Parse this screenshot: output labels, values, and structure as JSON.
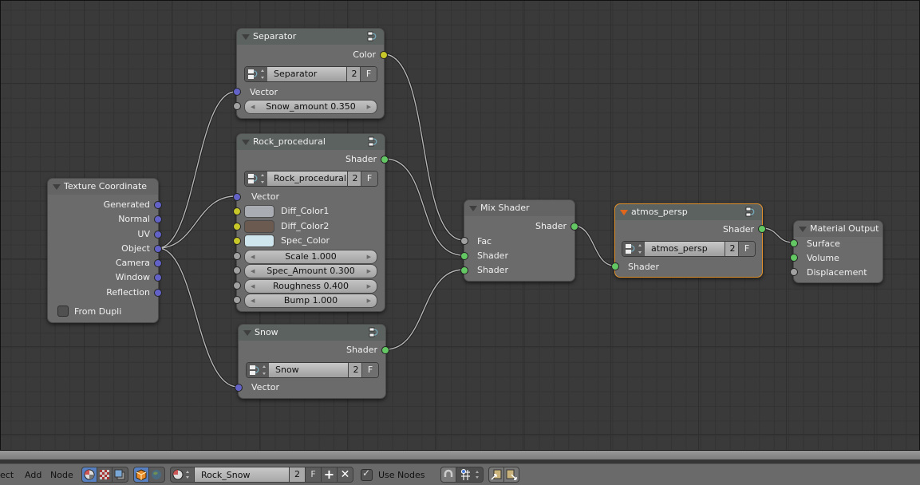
{
  "editor": {
    "colors": {
      "socket_vector": "#6363c7",
      "socket_color": "#c7c729",
      "socket_shader": "#63c763",
      "socket_value": "#a1a1a1",
      "active_outline": "#e0902a"
    },
    "nodes": {
      "texture_coordinate": {
        "title": "Texture Coordinate",
        "outputs": [
          "Generated",
          "Normal",
          "UV",
          "Object",
          "Camera",
          "Window",
          "Reflection"
        ],
        "from_dupli_label": "From Dupli",
        "from_dupli_checked": false
      },
      "separator": {
        "title": "Separator",
        "output_color": "Color",
        "group_name": "Separator",
        "users": "2",
        "fake_user": "F",
        "input_vector": "Vector",
        "snow_amount": "Snow_amount 0.350"
      },
      "rock_procedural": {
        "title": "Rock_procedural",
        "output_shader": "Shader",
        "group_name": "Rock_procedural",
        "users": "2",
        "fake_user": "F",
        "input_vector": "Vector",
        "colors": [
          {
            "label": "Diff_Color1",
            "value": "#a9adb3"
          },
          {
            "label": "Diff_Color2",
            "value": "#6b5a50"
          },
          {
            "label": "Spec_Color",
            "value": "#cfe6ee"
          }
        ],
        "values": [
          "Scale 1.000",
          "Spec_Amount 0.300",
          "Roughness 0.400",
          "Bump 1.000"
        ]
      },
      "snow": {
        "title": "Snow",
        "output_shader": "Shader",
        "group_name": "Snow",
        "users": "2",
        "fake_user": "F",
        "input_vector": "Vector"
      },
      "mix_shader": {
        "title": "Mix Shader",
        "output_shader": "Shader",
        "inputs": [
          "Fac",
          "Shader",
          "Shader"
        ]
      },
      "atmos_persp": {
        "title": "atmos_persp",
        "output_shader": "Shader",
        "group_name": "atmos_persp",
        "users": "2",
        "fake_user": "F",
        "input_shader": "Shader"
      },
      "material_output": {
        "title": "Material Output",
        "inputs": [
          "Surface",
          "Volume",
          "Displacement"
        ]
      }
    }
  },
  "header": {
    "menus": [
      "ect",
      "Add",
      "Node"
    ],
    "material_name": "Rock_Snow",
    "material_users": "2",
    "fake_user": "F",
    "use_nodes_label": "Use Nodes",
    "use_nodes_checked": true,
    "icons": {
      "shader_type": "material-sphere-icon",
      "texture_type": "checker-texture-icon",
      "compositing_type": "compositing-icon",
      "object_type": "object-cube-icon",
      "world_type": "world-icon",
      "snap": "magnet-icon",
      "snap_mode": "grid-snap-icon",
      "copy": "copy-clipboard-icon",
      "paste": "paste-clipboard-icon"
    }
  }
}
